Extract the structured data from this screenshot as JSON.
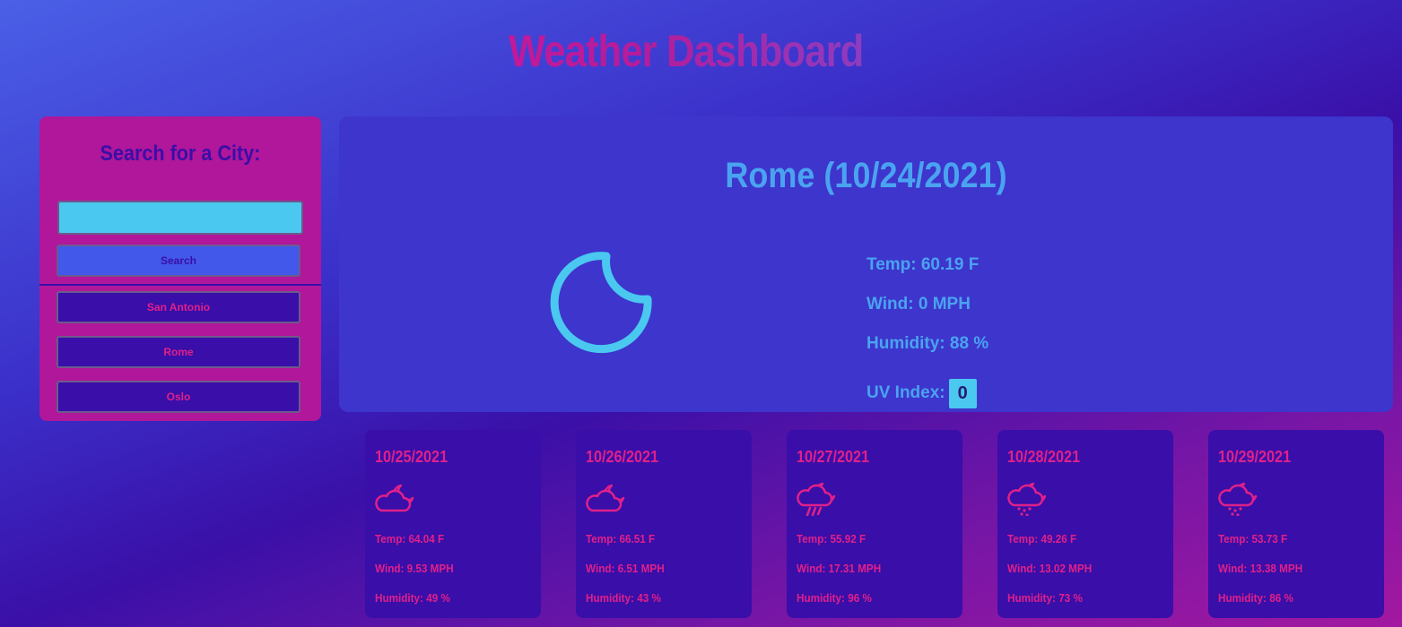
{
  "header": {
    "title": "Weather Dashboard"
  },
  "sidebar": {
    "heading": "Search for a City:",
    "search_input_value": "",
    "search_button": "Search",
    "history": [
      "San Antonio",
      "Rome",
      "Oslo"
    ]
  },
  "current": {
    "title": "Rome (10/24/2021)",
    "icon": "moon-icon",
    "temp": "Temp: 60.19 F",
    "wind": "Wind: 0 MPH",
    "humidity": "Humidity: 88 %",
    "uv_label": "UV Index:",
    "uv_value": "0"
  },
  "forecast": [
    {
      "date": "10/25/2021",
      "icon": "cloud-moon-icon",
      "temp": "Temp: 64.04 F",
      "wind": "Wind: 9.53 MPH",
      "humidity": "Humidity: 49 %"
    },
    {
      "date": "10/26/2021",
      "icon": "cloud-moon-icon",
      "temp": "Temp: 66.51 F",
      "wind": "Wind: 6.51 MPH",
      "humidity": "Humidity: 43 %"
    },
    {
      "date": "10/27/2021",
      "icon": "cloud-moon-rain-icon",
      "temp": "Temp: 55.92 F",
      "wind": "Wind: 17.31 MPH",
      "humidity": "Humidity: 96 %"
    },
    {
      "date": "10/28/2021",
      "icon": "cloud-moon-rain-icon",
      "temp": "Temp: 49.26 F",
      "wind": "Wind: 13.02 MPH",
      "humidity": "Humidity: 73 %"
    },
    {
      "date": "10/29/2021",
      "icon": "cloud-moon-rain-icon",
      "temp": "Temp: 53.73 F",
      "wind": "Wind: 13.38 MPH",
      "humidity": "Humidity: 86 %"
    }
  ],
  "colors": {
    "sidebar_bg": "#b0179a",
    "panel_bg": "#3d35cc",
    "card_bg": "#3a0ea8",
    "accent_pink": "#e0208a",
    "accent_blue": "#4aa3f0",
    "accent_cyan": "#4ac8ef"
  }
}
